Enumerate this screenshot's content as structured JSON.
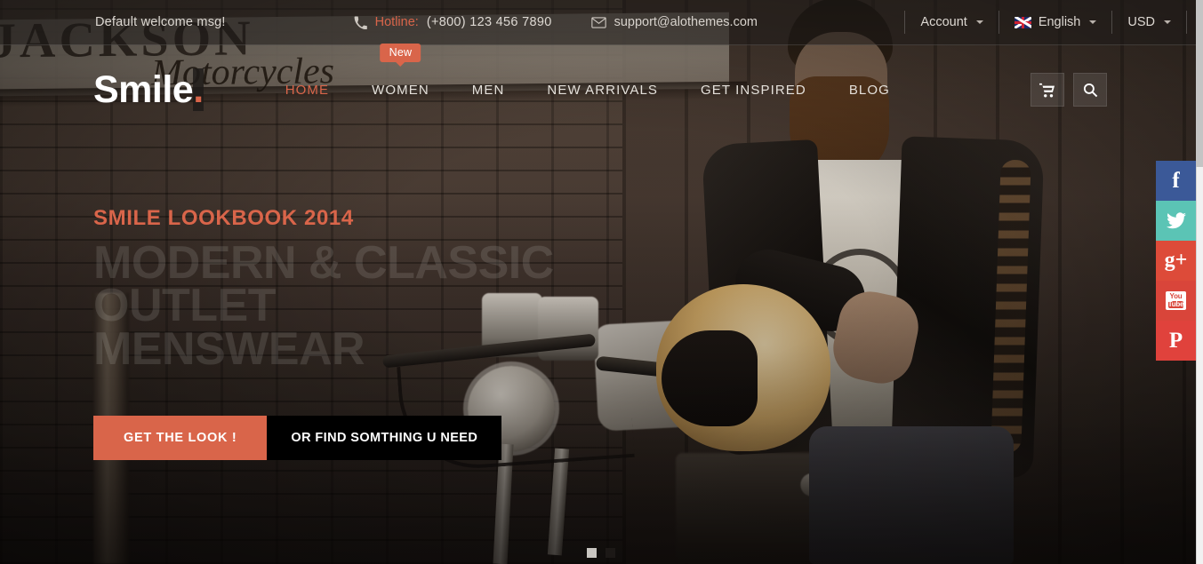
{
  "topbar": {
    "welcome": "Default welcome msg!",
    "phone_icon": "phone-icon",
    "hotline_label": "Hotline:",
    "hotline_number": "(+800) 123 456 7890",
    "mail_icon": "envelope-icon",
    "email": "support@alothemes.com",
    "account": "Account",
    "language": "English",
    "currency": "USD",
    "flag_icon": "uk-flag-icon"
  },
  "header": {
    "logo_text": "Smile",
    "logo_dot": ".",
    "nav": [
      {
        "label": "HOME",
        "active": true,
        "badge": ""
      },
      {
        "label": "WOMEN",
        "active": false,
        "badge": "New"
      },
      {
        "label": "MEN",
        "active": false,
        "badge": ""
      },
      {
        "label": "NEW ARRIVALS",
        "active": false,
        "badge": ""
      },
      {
        "label": "GET INSPIRED",
        "active": false,
        "badge": ""
      },
      {
        "label": "BLOG",
        "active": false,
        "badge": ""
      }
    ],
    "cart_icon": "shopping-cart-icon",
    "search_icon": "search-icon"
  },
  "hero": {
    "kicker": "SMILE LOOKBOOK 2014",
    "line1": "MODERN & CLASSIC",
    "line2": "OUTLET",
    "line3": "MENSWEAR",
    "cta_primary": "GET THE LOOK !",
    "cta_secondary": "OR FIND SOMTHING U NEED"
  },
  "slider": {
    "dots": [
      {
        "active": true
      },
      {
        "active": false
      }
    ]
  },
  "social": [
    {
      "name": "facebook",
      "glyph": "f",
      "color": "#3b5998"
    },
    {
      "name": "twitter",
      "glyph": "",
      "color": "#5bc4b5"
    },
    {
      "name": "google-plus",
      "glyph": "g+",
      "color": "#dd4b39"
    },
    {
      "name": "youtube",
      "glyph": "You Tube",
      "color": "#d9453a"
    },
    {
      "name": "pinterest",
      "glyph": "P",
      "color": "#e0423c"
    }
  ],
  "background": {
    "sign_line1": "JACKSON",
    "sign_line2": "Motorcycles"
  },
  "colors": {
    "accent": "#d9654a",
    "dark": "#000000",
    "text_light": "#ded9d3"
  }
}
